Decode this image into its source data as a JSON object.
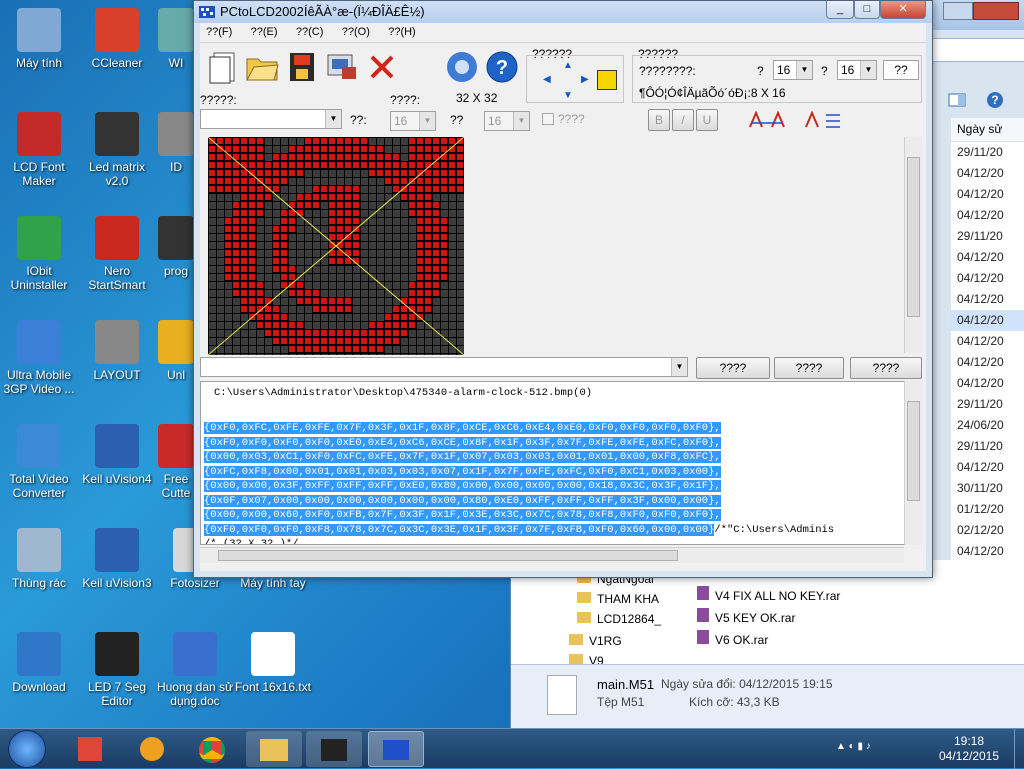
{
  "desktop_icons": [
    {
      "label": "Máy tính",
      "icon": "computer-icon"
    },
    {
      "label": "CCleaner",
      "icon": "ccleaner-icon"
    },
    {
      "label": "LCD Font Maker",
      "icon": "lcd-font-maker-icon"
    },
    {
      "label": "Led matrix v2.0",
      "icon": "led-matrix-icon"
    },
    {
      "label": "IObit Uninstaller",
      "icon": "iobit-icon"
    },
    {
      "label": "Nero StartSmart",
      "icon": "nero-icon"
    },
    {
      "label": "Ultra Mobile 3GP Video ...",
      "icon": "ultra-mobile-icon"
    },
    {
      "label": "LAYOUT",
      "icon": "layout-icon"
    },
    {
      "label": "Total Video Converter",
      "icon": "total-video-icon"
    },
    {
      "label": "Keil uVision4",
      "icon": "keil-icon"
    },
    {
      "label": "Thùng rác",
      "icon": "recycle-bin-icon"
    },
    {
      "label": "Keil uVision3",
      "icon": "keil3-icon"
    },
    {
      "label": "Fotosizer",
      "icon": "fotosizer-icon"
    },
    {
      "label": "Máy tính tay",
      "icon": "calculator-icon"
    },
    {
      "label": "Download",
      "icon": "download-icon"
    },
    {
      "label": "LED 7 Seg Editor",
      "icon": "led7seg-icon"
    },
    {
      "label": "Huong dan sử dụng.doc",
      "icon": "doc-icon"
    },
    {
      "label": "Font 16x16.txt",
      "icon": "txt-icon"
    },
    {
      "label": "WI",
      "icon": "app-icon"
    },
    {
      "label": "ID",
      "icon": "app-icon"
    },
    {
      "label": "prog",
      "icon": "app-icon"
    },
    {
      "label": "Unl",
      "icon": "app-icon"
    },
    {
      "label": "Free Cutte",
      "icon": "app-icon"
    }
  ],
  "app": {
    "title": "PCtoLCD2002ÍêÃÀ°æ-(Ï¼ÐÎÄ£Ê½)",
    "menu": [
      "??(F)",
      "??(E)",
      "??(C)",
      "??(O)",
      "??(H)"
    ],
    "size_label": "32 X 32",
    "panel1_title": "??????",
    "panel2_title": "??????",
    "panel2_line1": "????????:",
    "panel2_q1": "?",
    "panel2_q2": "?",
    "font_w": "16",
    "font_h": "16",
    "font_q": "??",
    "panel2_line2": "¶ÔÓ¦Ó¢ÎÄµãÕó´óÐ¡:8 X 16",
    "font_label": "?????:",
    "size_label2": "??:",
    "w_label": "????:",
    "h_label": "??",
    "w_value": "16",
    "h_value": "16",
    "check_label": "????",
    "btn_b": "B",
    "btn_i": "/",
    "btn_u": "U",
    "btn1": "????",
    "btn2": "????",
    "btn3": "????",
    "code_path": "C:\\Users\\Administrator\\Desktop\\475340-alarm-clock-512.bmp(0)",
    "code_lines": [
      "{0xF0,0xFC,0xFE,0xFE,0x7F,0x3F,0x1F,0x8F,0xCE,0xC6,0xE4,0xE0,0xF0,0xF0,0xF0,0xF0},",
      "{0xF0,0xF0,0xF0,0xF0,0xE0,0xE4,0xC6,0xCE,0x8F,0x1F,0x3F,0x7F,0xFE,0xFE,0xFC,0xF0},",
      "{0x00,0x03,0xC1,0xF0,0xFC,0xFE,0x7F,0x1F,0x07,0x03,0x03,0x01,0x01,0x00,0xF8,0xFC},",
      "{0xFC,0xF8,0x00,0x01,0x01,0x03,0x03,0x07,0x1F,0x7F,0xFE,0xFC,0xF0,0xC1,0x03,0x00},",
      "{0x00,0x00,0x3F,0xFF,0xFF,0xFF,0xE0,0x80,0x00,0x00,0x00,0x00,0x18,0x3C,0x3F,0x1F},",
      "{0x0F,0x07,0x00,0x00,0x00,0x00,0x00,0x00,0x80,0xE0,0xFF,0xFF,0xFF,0x3F,0x00,0x00},",
      "{0x00,0x00,0x60,0xF0,0xFB,0x7F,0x3F,0x1F,0x3E,0x3C,0x7C,0x78,0xF8,0xF0,0xF0,0xF0},",
      "{0xF0,0xF0,0xF0,0xF8,0x78,0x7C,0x3C,0x3E,0x1F,0x3F,0x7F,0xFB,0xF0,0x60,0x00,0x00}"
    ],
    "code_tail": "/*\"C:\\Users\\Adminis",
    "code_footer": "/* (32 X 32 )*/"
  },
  "explorer": {
    "col_header": "Ngày sử",
    "dates": [
      "29/11/20",
      "04/12/20",
      "04/12/20",
      "04/12/20",
      "29/11/20",
      "04/12/20",
      "04/12/20",
      "04/12/20",
      "04/12/20",
      "04/12/20",
      "04/12/20",
      "04/12/20",
      "29/11/20",
      "24/06/20",
      "29/11/20",
      "04/12/20",
      "30/11/20",
      "01/12/20",
      "02/12/20",
      "04/12/20",
      "03/12/20",
      "04/12/20",
      "04/12/20"
    ],
    "folders": [
      "NgatNgoai",
      "THAM KHA",
      "LCD12864_",
      "V1RG",
      "V9"
    ],
    "files": [
      "V4 FIX ALL NO KEY.rar",
      "V5 KEY OK.rar",
      "V6 OK.rar"
    ],
    "status_name": "main.M51",
    "status_modified": "Ngày sửa đổi: 04/12/2015 19:15",
    "status_type": "Tệp M51",
    "status_size": "Kích cỡ: 43,3 KB"
  },
  "taskbar": {
    "time": "19:18",
    "date": "04/12/2015"
  }
}
